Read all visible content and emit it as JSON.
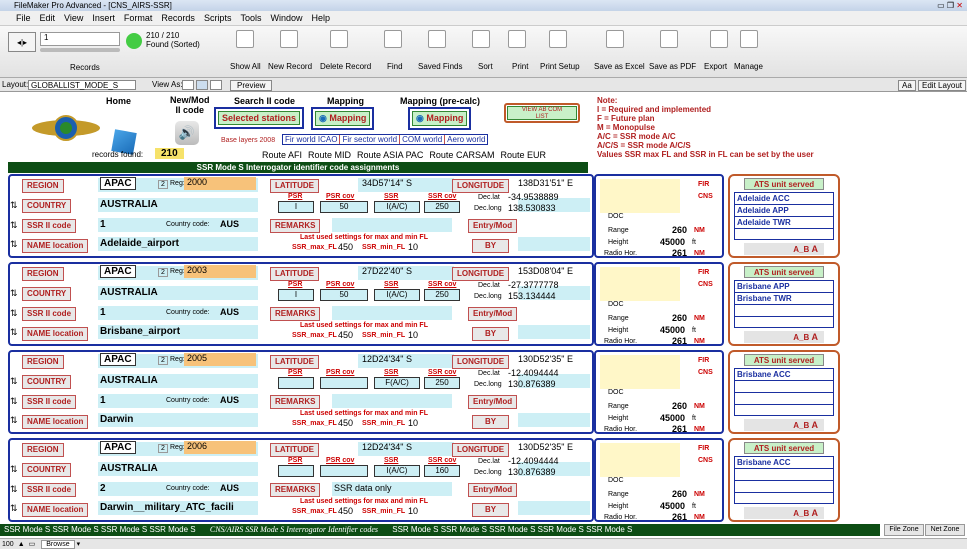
{
  "window": {
    "title": "FileMaker Pro Advanced - [CNS_AIRS-SSR]"
  },
  "menu": [
    "File",
    "Edit",
    "View",
    "Insert",
    "Format",
    "Records",
    "Scripts",
    "Tools",
    "Window",
    "Help"
  ],
  "toolbar": {
    "record_number": "1",
    "found_count": "210 / 210",
    "found_status": "Found (Sorted)",
    "records_label": "Records",
    "buttons": [
      "Show All",
      "New Record",
      "Delete Record",
      "Find",
      "Saved Finds",
      "Sort",
      "Print",
      "Print Setup",
      "Save as Excel",
      "Save as PDF",
      "Export",
      "Manage"
    ]
  },
  "layoutbar": {
    "layout_label": "Layout:",
    "layout_value": "GLOBALLIST_MODE_S",
    "view_as_label": "View As:",
    "preview_label": "Preview",
    "aa_label": "Aa",
    "edit_layout_label": "Edit Layout"
  },
  "header": {
    "home_label": "Home",
    "newmod_label": "New/Mod\nII code",
    "search_label": "Search II code",
    "selected_stations": "Selected stations",
    "mapping_label": "Mapping",
    "mapping_btn": "Mapping",
    "mapping_precalc_label": "Mapping (pre-calc)",
    "mapping_precalc_btn": "Mapping",
    "view_ab_com": "VIEW AB COM\nLIST",
    "base_layers": "Base layers 2008",
    "layer_links": [
      "Fir world ICAO",
      "Fir sector world",
      "COM world",
      "Aero world"
    ],
    "route_links": [
      "Route AFI",
      "Route MID",
      "Route ASIA PAC",
      "Route CARSAM",
      "Route EUR"
    ],
    "records_found_label": "records found:",
    "records_found_value": "210",
    "banner": "SSR Mode S Interrogator identifier code assignments",
    "note_title": "Note:",
    "notes": [
      "I = Required and implemented",
      "F = Future plan",
      "M = Monopulse",
      "A/C = SSR mode A/C",
      "A/C/S = SSR mode A/C/S",
      "Values SSR max FL and SSR in FL can be set by the user"
    ]
  },
  "labels": {
    "region": "REGION",
    "country": "COUNTRY",
    "ssr_ii_code": "SSR II code",
    "name_location": "NAME location",
    "country_code": "Country code:",
    "reg": "Reg:",
    "latitude": "LATITUDE",
    "longitude": "LONGITUDE",
    "psr": "PSR",
    "psr_cov": "PSR cov",
    "ssr": "SSR",
    "ssr_cov": "SSR cov",
    "dec_lat": "Dec.lat",
    "dec_long": "Dec.long",
    "remarks": "REMARKS",
    "entry_mod": "Entry/Mod",
    "by": "BY",
    "last_used": "Last used settings for max and min FL",
    "ssr_max_fl": "SSR_max_FL",
    "ssr_min_fl": "SSR_min_FL",
    "fir": "FIR",
    "cns": "CNS",
    "doc": "DOC",
    "range": "Range",
    "height": "Height",
    "radio_hor": "Radio Hor.",
    "nm": "NM",
    "ft": "ft",
    "ats_unit": "ATS unit served",
    "ab": "A_B"
  },
  "records": [
    {
      "region": "APAC",
      "reg_num": "2",
      "reg": "2000",
      "country": "AUSTRALIA",
      "ssr_code": "1",
      "country_code": "AUS",
      "name": "Adelaide_airport",
      "latitude": "34D57'14\"  S",
      "longitude": "138D31'51\" E",
      "psr": "I",
      "psr_cov": "50",
      "ssr": "I(A/C)",
      "ssr_cov": "250",
      "dec_lat": "-34.9538889",
      "dec_long": "138.530833",
      "remarks": "",
      "max_fl": "450",
      "min_fl": "10",
      "range": "260",
      "height": "45000",
      "radio_hor": "261",
      "ats": [
        "Adelaide ACC",
        "Adelaide APP",
        "Adelaide TWR"
      ],
      "ab": "A"
    },
    {
      "region": "APAC",
      "reg_num": "2",
      "reg": "2003",
      "country": "AUSTRALIA",
      "ssr_code": "1",
      "country_code": "AUS",
      "name": "Brisbane_airport",
      "latitude": "27D22'40\"  S",
      "longitude": "153D08'04\" E",
      "psr": "I",
      "psr_cov": "50",
      "ssr": "I(A/C)",
      "ssr_cov": "250",
      "dec_lat": "-27.3777778",
      "dec_long": "153.134444",
      "remarks": "",
      "max_fl": "450",
      "min_fl": "10",
      "range": "260",
      "height": "45000",
      "radio_hor": "261",
      "ats": [
        "Brisbane APP",
        "Brisbane TWR"
      ],
      "ab": "A"
    },
    {
      "region": "APAC",
      "reg_num": "2",
      "reg": "2005",
      "country": "AUSTRALIA",
      "ssr_code": "1",
      "country_code": "AUS",
      "name": "Darwin",
      "latitude": "12D24'34\"  S",
      "longitude": "130D52'35\" E",
      "psr": "",
      "psr_cov": "",
      "ssr": "F(A/C)",
      "ssr_cov": "250",
      "dec_lat": "-12.4094444",
      "dec_long": "130.876389",
      "remarks": "",
      "max_fl": "450",
      "min_fl": "10",
      "range": "260",
      "height": "45000",
      "radio_hor": "261",
      "ats": [
        "Brisbane ACC"
      ],
      "ab": "A"
    },
    {
      "region": "APAC",
      "reg_num": "2",
      "reg": "2006",
      "country": "AUSTRALIA",
      "ssr_code": "2",
      "country_code": "AUS",
      "name": "Darwin__military_ATC_facili",
      "latitude": "12D24'34\"  S",
      "longitude": "130D52'35\" E",
      "psr": "",
      "psr_cov": "",
      "ssr": "I(A/C)",
      "ssr_cov": "160",
      "dec_lat": "-12.4094444",
      "dec_long": "130.876389",
      "remarks": "SSR data only",
      "max_fl": "450",
      "min_fl": "10",
      "range": "260",
      "height": "45000",
      "radio_hor": "261",
      "ats": [
        "Brisbane ACC"
      ],
      "ab": "A"
    }
  ],
  "footer": {
    "left": "SSR Mode S SSR Mode S SSR Mode S SSR Mode S",
    "center": "CNS/AIRS SSR Mode S Interrogator Identifier codes",
    "right": "SSR Mode S SSR Mode S SSR Mode S SSR Mode S SSR Mode S",
    "file_zone": "File Zone",
    "net_zone": "Net Zone"
  },
  "statusbar": {
    "zoom": "100",
    "mode": "Browse"
  }
}
